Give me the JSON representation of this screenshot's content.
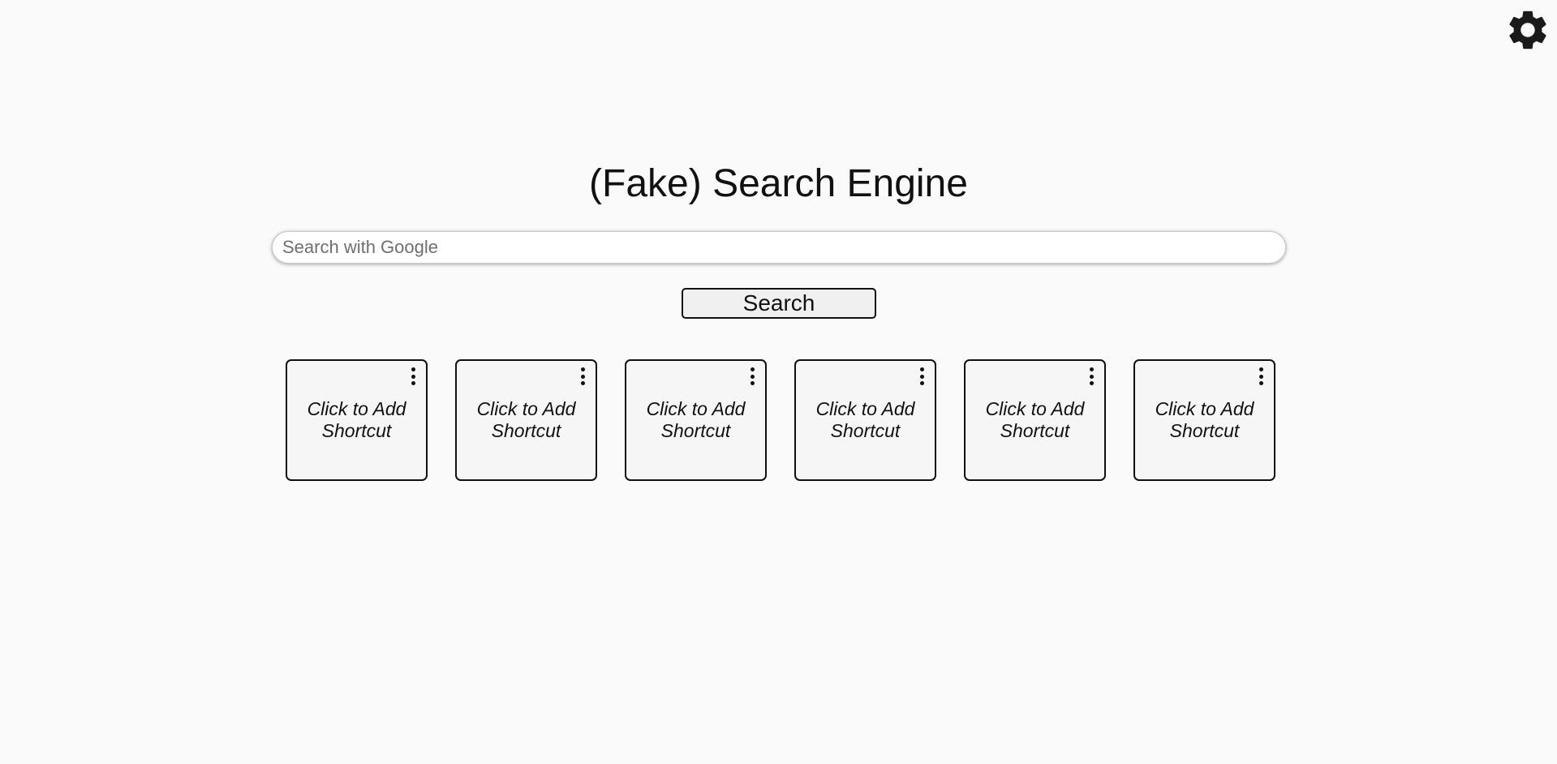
{
  "page": {
    "title": "(Fake) Search Engine"
  },
  "search": {
    "placeholder": "Search with Google",
    "value": "",
    "button_label": "Search"
  },
  "settings": {
    "icon": "gear-icon"
  },
  "shortcuts": [
    {
      "label": "Click to Add Shortcut",
      "icon": "more-vertical-icon"
    },
    {
      "label": "Click to Add Shortcut",
      "icon": "more-vertical-icon"
    },
    {
      "label": "Click to Add Shortcut",
      "icon": "more-vertical-icon"
    },
    {
      "label": "Click to Add Shortcut",
      "icon": "more-vertical-icon"
    },
    {
      "label": "Click to Add Shortcut",
      "icon": "more-vertical-icon"
    },
    {
      "label": "Click to Add Shortcut",
      "icon": "more-vertical-icon"
    }
  ],
  "colors": {
    "background": "#fafafa",
    "text": "#111111",
    "button_bg": "#f0f0f0"
  }
}
